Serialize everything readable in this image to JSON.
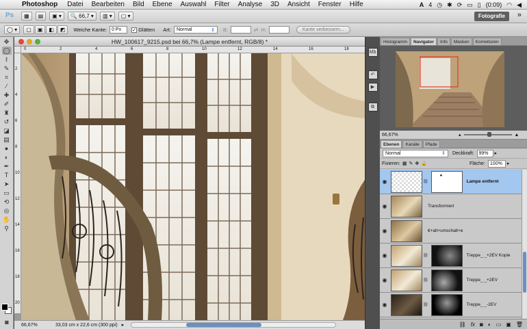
{
  "menubar": {
    "app_name": "Photoshop",
    "items": [
      "Datei",
      "Bearbeiten",
      "Bild",
      "Ebene",
      "Auswahl",
      "Filter",
      "Analyse",
      "3D",
      "Ansicht",
      "Fenster",
      "Hilfe"
    ],
    "status_text": "(0:09)",
    "adobe_badge": "4"
  },
  "appbar": {
    "logo": "Ps",
    "zoom": "66,7",
    "workspace": "Fotografie",
    "more": "»"
  },
  "options": {
    "feather_label": "Weiche Kante:",
    "feather_value": "0 Px",
    "antialias_label": "Glätten",
    "style_label": "Art:",
    "style_value": "Normal",
    "width_label": "B:",
    "height_label": "H:",
    "refine_button": "Kante verbessern..."
  },
  "document": {
    "title": "HW_100617_9215.psd bei 66,7% (Lampe entfernt, RGB/8) *",
    "zoom_status": "66,67%",
    "size_status": "33,03 cm x 22,6 cm (300 ppi)",
    "ruler_h": [
      "0",
      "2",
      "4",
      "6",
      "8",
      "10",
      "12",
      "14",
      "16",
      "18"
    ],
    "ruler_v": [
      "2",
      "4",
      "6",
      "8",
      "10",
      "12",
      "14",
      "16",
      "18",
      "20"
    ]
  },
  "navigator": {
    "tabs": [
      "Histogramm",
      "Navigator",
      "Info",
      "Masken",
      "Korrekturen"
    ],
    "active_tab": "Navigator",
    "zoom": "66,67%"
  },
  "layers_panel": {
    "tabs": [
      "Ebenen",
      "Kanäle",
      "Pfade"
    ],
    "blend_mode": "Normal",
    "opacity_label": "Deckkraft:",
    "opacity_value": "99%",
    "lock_label": "Fixieren:",
    "fill_label": "Fläche:",
    "fill_value": "100%",
    "layers": [
      {
        "name": "Lampe entfernt",
        "selected": true
      },
      {
        "name": "Transformiert",
        "selected": false
      },
      {
        "name": "€+alt+umschalt+e",
        "selected": false
      },
      {
        "name": "Treppe_ _+2EV Kopie",
        "selected": false
      },
      {
        "name": "Treppe_ _+2EV",
        "selected": false
      },
      {
        "name": "Treppe_ _-2EV",
        "selected": false
      }
    ]
  },
  "colors": {
    "selection": "#a3c7ee",
    "workspace_button": "#5f5f5f",
    "scroll_thumb": "#6c8fc0"
  }
}
